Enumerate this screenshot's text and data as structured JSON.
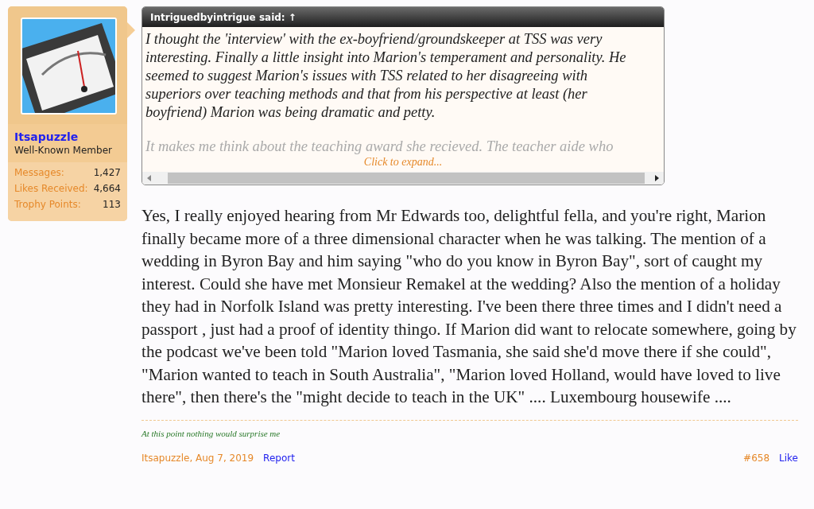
{
  "user": {
    "name": "Itsapuzzle",
    "title": "Well-Known Member",
    "stats": [
      {
        "label": "Messages:",
        "value": "1,427"
      },
      {
        "label": "Likes Received:",
        "value": "4,664"
      },
      {
        "label": "Trophy Points:",
        "value": "113"
      }
    ]
  },
  "quote": {
    "author": "Intriguedbyintrigue said:",
    "arrow": "↑",
    "paragraphs": [
      "I thought the 'interview' with the ex-boyfriend/groundskeeper at TSS was very interesting. Finally a little insight into Marion's temperament and personality. He seemed to suggest Marion's issues with TSS related to her disagreeing with superiors over teaching methods and that from his perspective at least (her boyfriend) Marion was being dramatic and petty.",
      "It makes me think about the teaching award she recieved. The teacher aide who"
    ],
    "expand": "Click to expand..."
  },
  "message": "Yes, I really enjoyed hearing from Mr Edwards too, delightful fella, and you're right, Marion finally became more of a three dimensional character when he was talking. The mention of a wedding in Byron Bay and him saying \"who do you know in Byron Bay\", sort of caught my interest. Could she have met Monsieur Remakel at the wedding? Also the mention of a holiday they had in Norfolk Island was pretty interesting. I've been there three times and I didn't need a passport , just had a proof of identity thingo. If Marion did want to relocate somewhere, going by the podcast we've been told \"Marion loved Tasmania, she said she'd move there if she could\", \"Marion wanted to teach in South Australia\", \"Marion loved Holland, would have loved to live there\", then there's the \"might decide to teach in the UK\" .... Luxembourg housewife ....",
  "signature": "At this point nothing would surprise me",
  "footer": {
    "author_date": "Itsapuzzle, Aug 7, 2019",
    "report": "Report",
    "post_number": "#658",
    "like": "Like"
  }
}
